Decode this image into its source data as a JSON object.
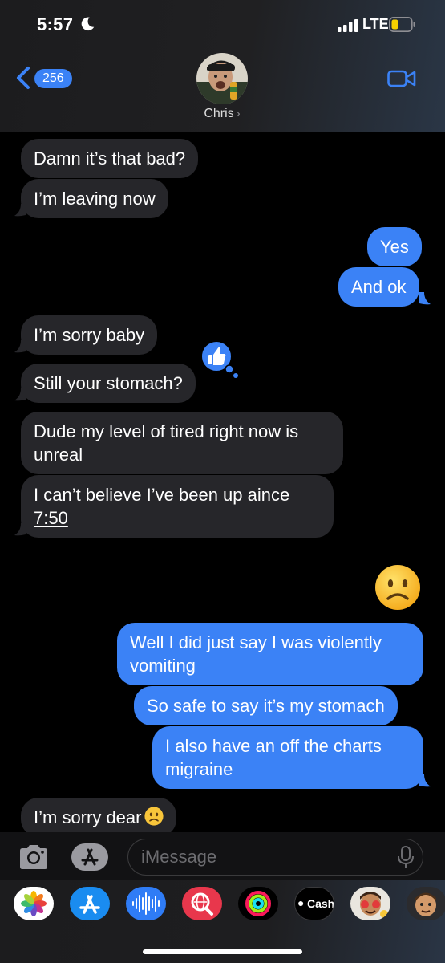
{
  "status_bar": {
    "time": "5:57",
    "network": "LTE",
    "icons": [
      "moon-icon",
      "signal-icon",
      "battery-icon"
    ]
  },
  "header": {
    "back_count": "256",
    "contact_name": "Chris",
    "chevron": "›"
  },
  "messages": [
    {
      "from": "them",
      "text": "Damn it’s that bad?"
    },
    {
      "from": "them",
      "text": "I’m leaving now"
    },
    {
      "from": "me",
      "text": "Yes"
    },
    {
      "from": "me",
      "text": "And ok"
    },
    {
      "from": "them",
      "text": "I’m sorry baby",
      "tapback": "thumbs-up-icon"
    },
    {
      "from": "them",
      "text": "Still your stomach?"
    },
    {
      "from": "them",
      "text": "Dude my level of tired right now is unreal"
    },
    {
      "from": "them",
      "text": "I can’t believe I’ve been up aince ",
      "link_text": "7:50"
    },
    {
      "from": "me",
      "emoji": "frowning-face-icon"
    },
    {
      "from": "me",
      "text": "Well I did just say I was violently vomiting"
    },
    {
      "from": "me",
      "text": "So safe to say it’s my stomach"
    },
    {
      "from": "me",
      "text": "I also have an off the charts migraine"
    },
    {
      "from": "them",
      "text": "I’m sorry dear",
      "emoji": "frowning-face-icon"
    }
  ],
  "composer": {
    "placeholder": "iMessage"
  },
  "app_drawer": {
    "apps": [
      "photos-icon",
      "app-store-icon",
      "audio-message-icon",
      "images-search-icon",
      "activity-icon",
      "apple-cash-icon",
      "memoji-icon",
      "memoji-2-icon"
    ],
    "cash_label": "Cash"
  },
  "colors": {
    "outgoing": "#3b82f6",
    "incoming": "#26262a",
    "background": "#000000"
  }
}
